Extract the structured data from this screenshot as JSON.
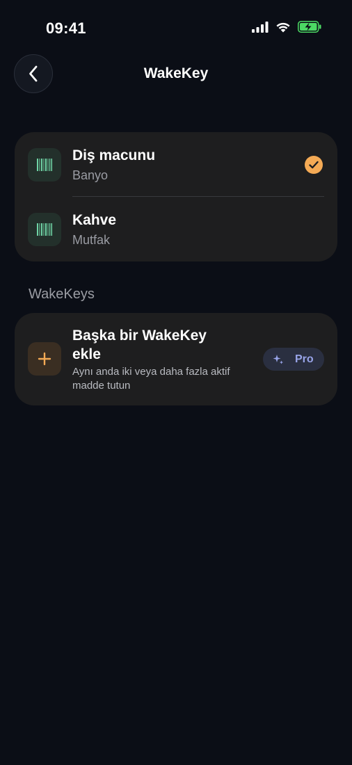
{
  "status_bar": {
    "time": "09:41"
  },
  "nav": {
    "title": "WakeKey"
  },
  "items": [
    {
      "title": "Diş macunu",
      "subtitle": "Banyo",
      "selected": true
    },
    {
      "title": "Kahve",
      "subtitle": "Mutfak",
      "selected": false
    }
  ],
  "section": {
    "label": "WakeKeys"
  },
  "add_card": {
    "title": "Başka bir WakeKey ekle",
    "description": "Aynı anda iki veya daha fazla aktif madde tutun",
    "badge": "Pro"
  },
  "colors": {
    "background": "#0b0e16",
    "card": "#1e1e1f",
    "accent_orange": "#f4aa55",
    "barcode_green": "#6fd3a5",
    "pro_purple": "#98a4e8"
  },
  "icons": {
    "back": "chevron-left-icon",
    "item": "barcode-icon",
    "check": "checkmark-icon",
    "add": "plus-icon",
    "pro": "sparkle-icon"
  }
}
